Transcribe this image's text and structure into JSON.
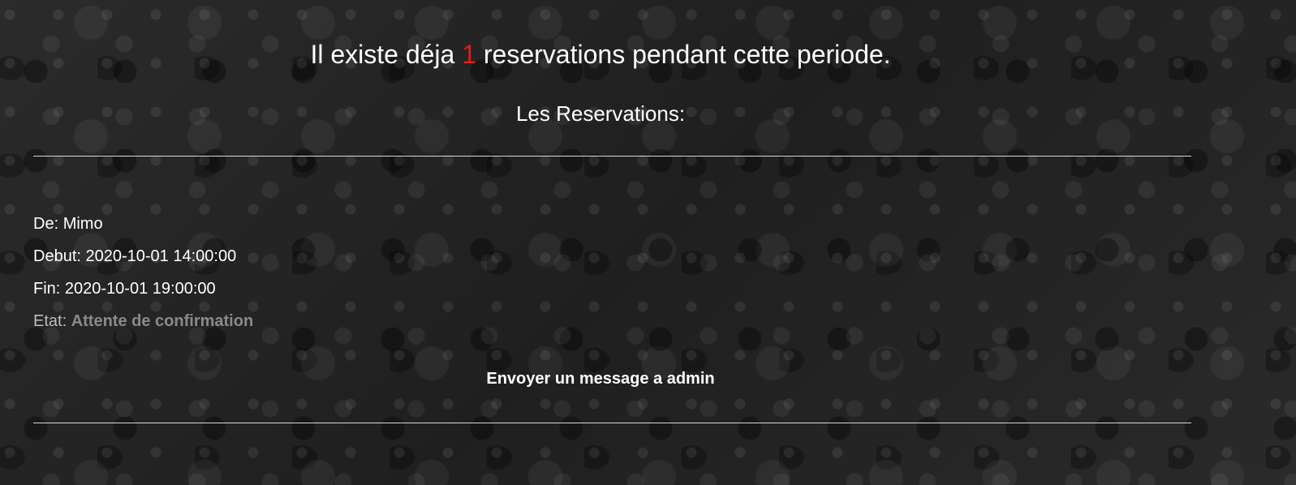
{
  "header": {
    "prefix": "Il existe déja",
    "count": "1",
    "suffix": "reservations pendant cette periode."
  },
  "section_title": "Les Reservations:",
  "reservation": {
    "from_label": "De:",
    "from_value": "Mimo",
    "start_label": "Debut:",
    "start_value": "2020-10-01 14:00:00",
    "end_label": "Fin:",
    "end_value": "2020-10-01 19:00:00",
    "status_label": "Etat:",
    "status_value": "Attente de confirmation"
  },
  "actions": {
    "message_admin": "Envoyer un message a admin"
  },
  "colors": {
    "count_accent": "#e01e1e",
    "status_value": "#8a8a8a",
    "text": "#ffffff"
  }
}
